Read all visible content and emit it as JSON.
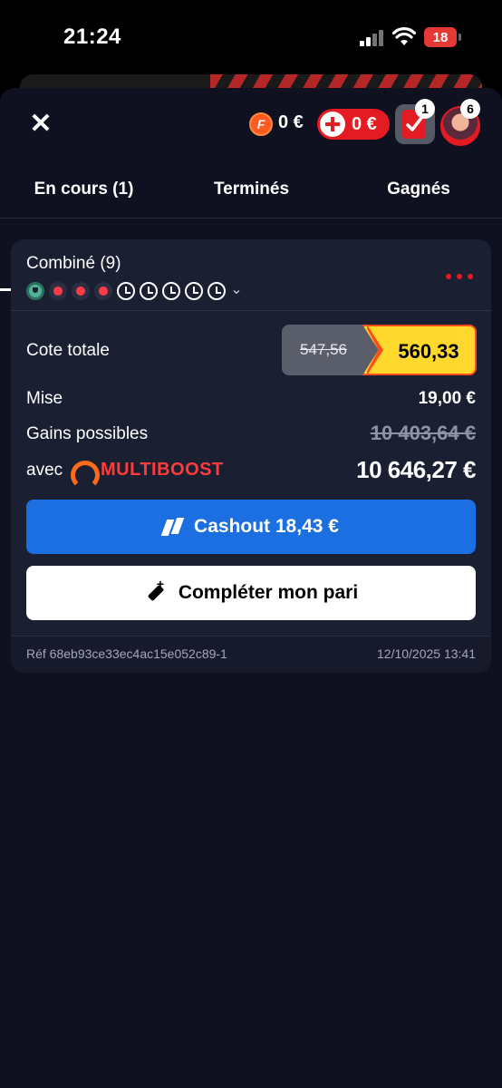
{
  "status": {
    "time": "21:24",
    "battery": "18"
  },
  "header": {
    "f_balance": "0 €",
    "f_coin_letter": "F",
    "bonus_balance": "0 €",
    "betslip_count": "1",
    "avatar_count": "6"
  },
  "tabs": [
    {
      "label": "En cours (1)",
      "active": true
    },
    {
      "label": "Terminés",
      "active": false
    },
    {
      "label": "Gagnés",
      "active": false
    }
  ],
  "bet": {
    "title": "Combiné (9)",
    "legs": [
      "won",
      "lost",
      "lost",
      "lost",
      "pending",
      "pending",
      "pending",
      "pending",
      "pending"
    ],
    "odds_label": "Cote totale",
    "odds_old": "547,56",
    "odds_new": "560,33",
    "stake_label": "Mise",
    "stake_value": "19,00 €",
    "gains_label": "Gains possibles",
    "gains_old": "10 403,64 €",
    "boost_prefix": "avec",
    "boost_name": "MULTIBOOST",
    "gains_boosted": "10 646,27 €",
    "cashout_label": "Cashout 18,43 €",
    "complete_label": "Compléter mon pari",
    "ref": "Réf 68eb93ce33ec4ac15e052c89-1",
    "date": "12/10/2025 13:41"
  },
  "colors": {
    "accent_red": "#e41b23",
    "cashout_blue": "#1b6fe0",
    "odds_yellow": "#ffd82e",
    "boost_orange": "#ff6a1a"
  }
}
